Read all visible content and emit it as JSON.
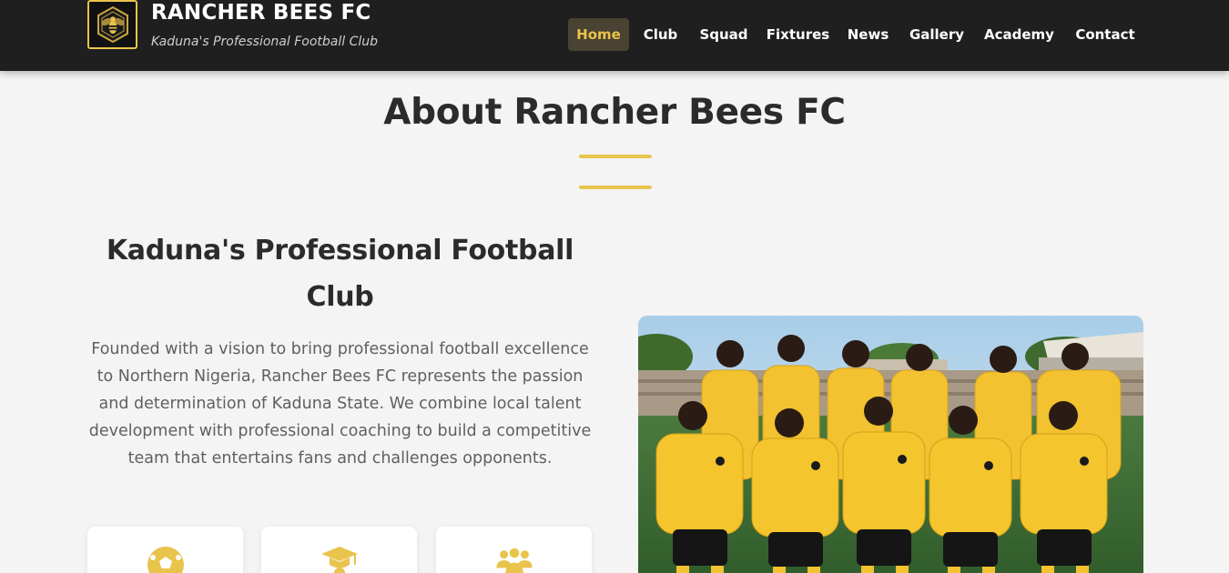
{
  "header": {
    "brand_title": "RANCHER BEES FC",
    "brand_subtitle": "Kaduna's Professional Football Club",
    "logo_icon": "bee-crest-icon"
  },
  "nav": {
    "items": [
      {
        "label": "Home",
        "active": true
      },
      {
        "label": "Club",
        "active": false
      },
      {
        "label": "Squad",
        "active": false
      },
      {
        "label": "Fixtures",
        "active": false
      },
      {
        "label": "News",
        "active": false
      },
      {
        "label": "Gallery",
        "active": false
      },
      {
        "label": "Academy",
        "active": false
      },
      {
        "label": "Contact",
        "active": false
      }
    ]
  },
  "about": {
    "title": "About Rancher Bees FC",
    "subtitle": "Kaduna's Professional Football Club",
    "description": "Founded with a vision to bring professional football excellence to Northern Nigeria, Rancher Bees FC represents the passion and determination of Kaduna State. We combine local talent development with professional coaching to build a competitive team that entertains fans and challenges opponents.",
    "cards": [
      {
        "icon": "football-icon"
      },
      {
        "icon": "graduation-cap-icon"
      },
      {
        "icon": "users-group-icon"
      }
    ],
    "photo": {
      "subject": "team-photo"
    }
  },
  "colors": {
    "accent": "#e8c44c",
    "nav_bg": "#1f1f1f",
    "page_bg": "#f4f4f4",
    "heading": "#2b2b2b",
    "body_text": "#606060"
  }
}
